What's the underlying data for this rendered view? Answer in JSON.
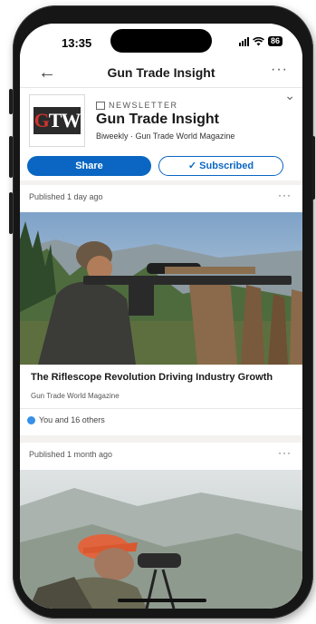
{
  "status": {
    "time": "13:35",
    "battery": "86"
  },
  "appbar": {
    "title": "Gun Trade Insight",
    "back_icon": "arrow-left-icon",
    "more_icon": "more-icon",
    "more_glyph": "···"
  },
  "newsletter": {
    "logo_text_red": "G",
    "logo_text_white": "TW",
    "kicker": "NEWSLETTER",
    "title": "Gun Trade Insight",
    "subtitle": "Biweekly · Gun Trade World Magazine",
    "share_label": "Share",
    "subscribed_label": "✓ Subscribed"
  },
  "posts": [
    {
      "published": "Published 1 day ago",
      "title": "The Riflescope Revolution Driving Industry Growth",
      "source": "Gun Trade World Magazine",
      "reactions": "You and 16 others"
    },
    {
      "published": "Published 1 month ago"
    }
  ],
  "colors": {
    "accent": "#0a66c2",
    "like": "#378fe9"
  }
}
